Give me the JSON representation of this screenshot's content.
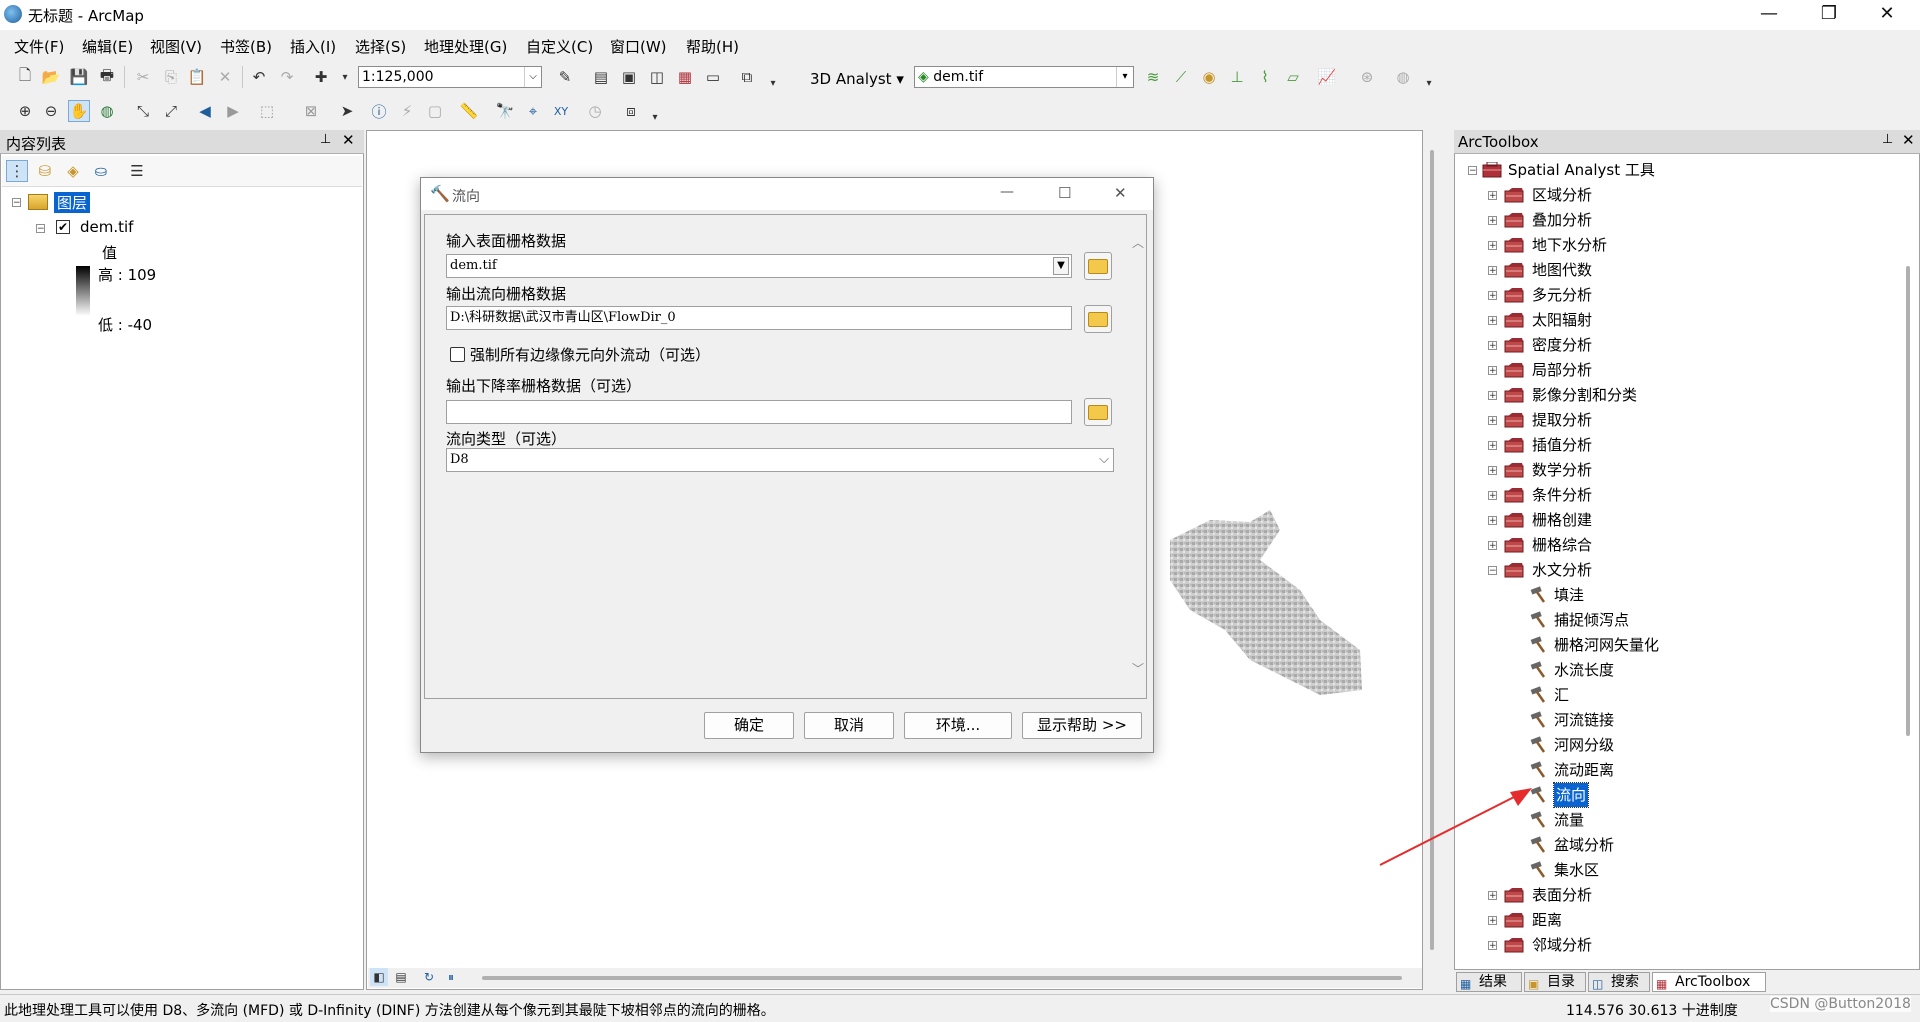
{
  "window": {
    "title": "无标题 - ArcMap",
    "minimize": "—",
    "restore": "❐",
    "close": "✕"
  },
  "menu": [
    "文件(F)",
    "编辑(E)",
    "视图(V)",
    "书签(B)",
    "插入(I)",
    "选择(S)",
    "地理处理(G)",
    "自定义(C)",
    "窗口(W)",
    "帮助(H)"
  ],
  "toolbar": {
    "scale": "1:125,000",
    "analyst_label": "3D Analyst",
    "layer_combo": "dem.tif"
  },
  "toc": {
    "title": "内容列表",
    "layers_label": "图层",
    "layer_name": "dem.tif",
    "value_label": "值",
    "high_label": "高 : 109",
    "low_label": "低 : -40"
  },
  "dialog": {
    "title": "流向",
    "input_label": "输入表面栅格数据",
    "input_value": "dem.tif",
    "output_label": "输出流向栅格数据",
    "output_value": "D:\\科研数据\\武汉市青山区\\FlowDir_0",
    "force_edge_label": "强制所有边缘像元向外流动（可选）",
    "force_edge_checked": false,
    "drop_label": "输出下降率栅格数据（可选）",
    "drop_value": "",
    "type_label": "流向类型（可选）",
    "type_value": "D8",
    "buttons": {
      "ok": "确定",
      "cancel": "取消",
      "env": "环境...",
      "help": "显示帮助 >>"
    }
  },
  "arctoolbox": {
    "title": "ArcToolbox",
    "root": "Spatial Analyst 工具",
    "toolsets_before": [
      "区域分析",
      "叠加分析",
      "地下水分析",
      "地图代数",
      "多元分析",
      "太阳辐射",
      "密度分析",
      "局部分析",
      "影像分割和分类",
      "提取分析",
      "插值分析",
      "数学分析",
      "条件分析",
      "栅格创建",
      "栅格综合"
    ],
    "expanded": "水文分析",
    "tools": [
      "填洼",
      "捕捉倾泻点",
      "栅格河网矢量化",
      "水流长度",
      "汇",
      "河流链接",
      "河网分级",
      "流动距离",
      "流向",
      "流量",
      "盆域分析",
      "集水区"
    ],
    "selected_tool": "流向",
    "toolsets_after": [
      "表面分析",
      "距离",
      "邻域分析"
    ],
    "tabs": [
      "结果",
      "目录",
      "搜索",
      "ArcToolbox"
    ]
  },
  "status": {
    "message": "此地理处理工具可以使用 D8、多流向 (MFD) 或 D-Infinity (DINF) 方法创建从每个像元到其最陡下坡相邻点的流向的栅格。",
    "coords": "114.576  30.613 十进制度",
    "watermark": "CSDN @Button2018"
  },
  "colors": {
    "selection": "#0a64d0",
    "arrow": "#e52b2b",
    "toolbox_red": "#b0303a"
  }
}
